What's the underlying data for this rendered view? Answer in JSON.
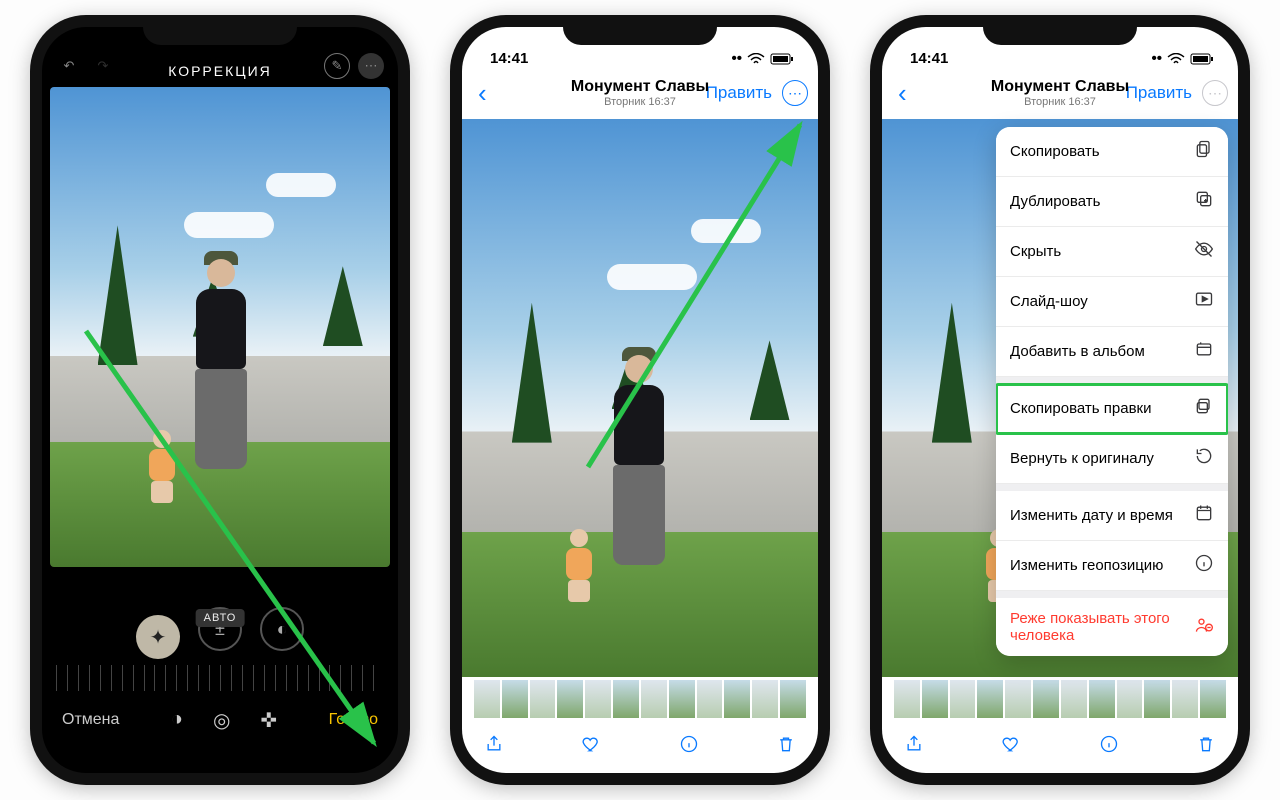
{
  "phone1": {
    "title": "КОРРЕКЦИЯ",
    "auto_label": "АВТО",
    "cancel": "Отмена",
    "done": "Готово"
  },
  "phone2": {
    "time": "14:41",
    "location_title": "Монумент Славы",
    "subtitle": "Вторник 16:37",
    "edit": "Править"
  },
  "phone3": {
    "time": "14:41",
    "location_title": "Монумент Славы",
    "subtitle": "Вторник 16:37",
    "edit": "Править",
    "menu": [
      {
        "label": "Скопировать",
        "icon": "copy"
      },
      {
        "label": "Дублировать",
        "icon": "duplicate"
      },
      {
        "label": "Скрыть",
        "icon": "hide"
      },
      {
        "label": "Слайд-шоу",
        "icon": "play"
      },
      {
        "label": "Добавить в альбом",
        "icon": "album"
      },
      {
        "label": "Скопировать правки",
        "icon": "copy-edits",
        "highlight": true
      },
      {
        "label": "Вернуть к оригиналу",
        "icon": "revert"
      },
      {
        "label": "Изменить дату и время",
        "icon": "calendar"
      },
      {
        "label": "Изменить геопозицию",
        "icon": "location"
      },
      {
        "label": "Реже показывать этого человека",
        "icon": "person",
        "danger": true
      }
    ]
  }
}
